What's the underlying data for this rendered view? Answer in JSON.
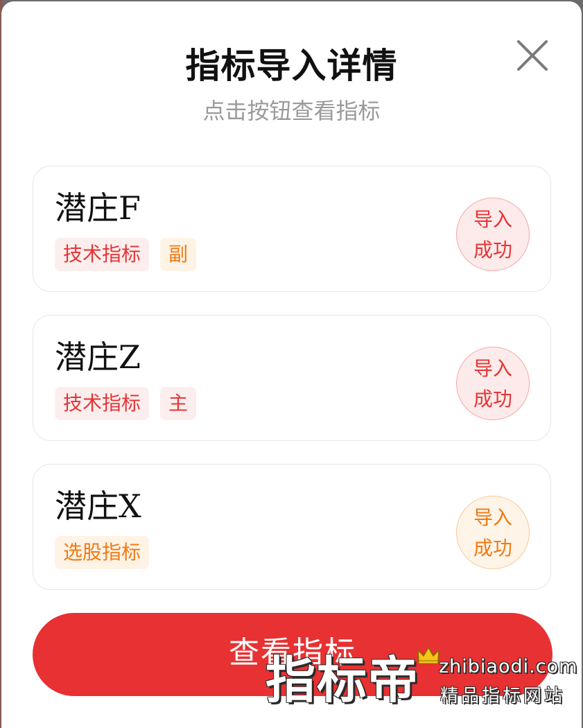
{
  "dialog": {
    "title": "指标导入详情",
    "subtitle": "点击按钮查看指标",
    "close_icon": "close-icon"
  },
  "items": [
    {
      "name": "潜庄F",
      "tags": [
        {
          "label": "技术指标",
          "color": "red"
        },
        {
          "label": "副",
          "color": "orange"
        }
      ],
      "status": {
        "line1": "导入",
        "line2": "成功",
        "color": "red"
      }
    },
    {
      "name": "潜庄Z",
      "tags": [
        {
          "label": "技术指标",
          "color": "red"
        },
        {
          "label": "主",
          "color": "red"
        }
      ],
      "status": {
        "line1": "导入",
        "line2": "成功",
        "color": "red"
      }
    },
    {
      "name": "潜庄X",
      "tags": [
        {
          "label": "选股指标",
          "color": "orange"
        }
      ],
      "status": {
        "line1": "导入",
        "line2": "成功",
        "color": "orange"
      }
    }
  ],
  "view_button": {
    "label": "查看指标"
  },
  "watermark": {
    "brand": "指标帝",
    "url": "zhibiaodi.com",
    "slogan": "精品指标网站"
  },
  "colors": {
    "accent_red": "#e83132",
    "tag_red": "#e43535",
    "tag_orange": "#f07a13"
  }
}
